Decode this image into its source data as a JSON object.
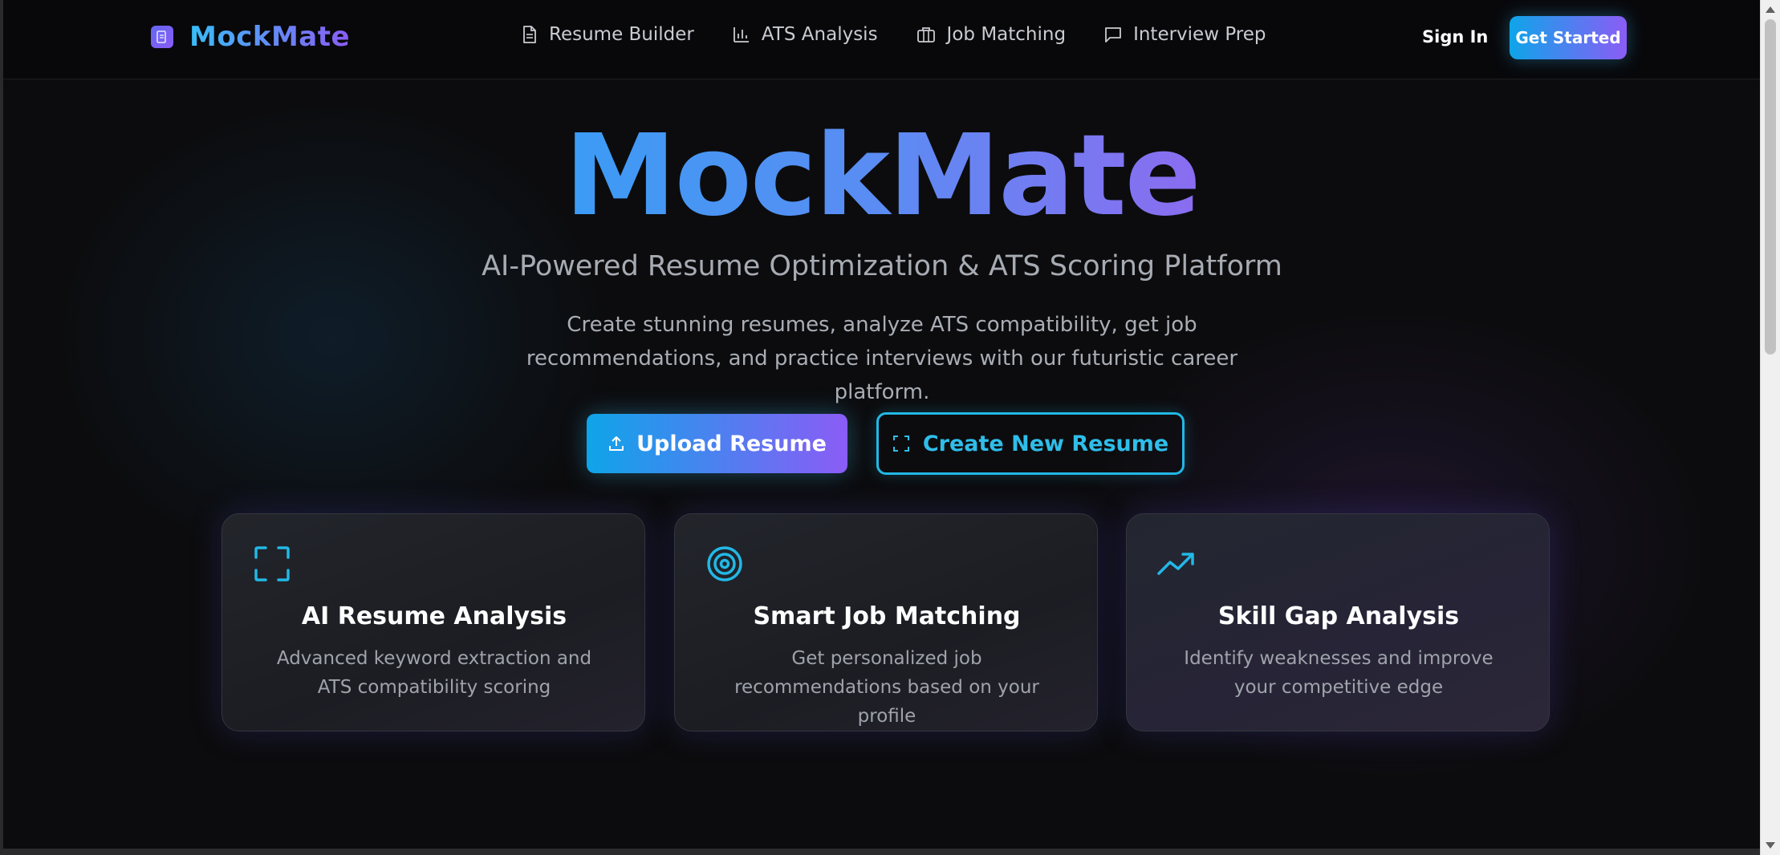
{
  "nav": {
    "brand": "MockMate",
    "links": [
      {
        "label": "Resume Builder",
        "icon": "document-icon"
      },
      {
        "label": "ATS Analysis",
        "icon": "bar-chart-icon"
      },
      {
        "label": "Job Matching",
        "icon": "briefcase-icon"
      },
      {
        "label": "Interview Prep",
        "icon": "message-square-icon"
      }
    ],
    "sign_in": "Sign In",
    "get_started": "Get Started"
  },
  "hero": {
    "title": "MockMate",
    "subtitle": "AI-Powered Resume Optimization & ATS Scoring Platform",
    "description": "Create stunning resumes, analyze ATS compatibility, get job recommendations, and practice interviews with our futuristic career platform.",
    "upload_button": "Upload Resume",
    "create_button": "Create New Resume"
  },
  "features": [
    {
      "title": "AI Resume Analysis",
      "description": "Advanced keyword extraction and ATS compatibility scoring",
      "icon": "scan-icon"
    },
    {
      "title": "Smart Job Matching",
      "description": "Get personalized job recommendations based on your profile",
      "icon": "target-icon"
    },
    {
      "title": "Skill Gap Analysis",
      "description": "Identify weaknesses and improve your competitive edge",
      "icon": "trending-up-icon"
    }
  ],
  "colors": {
    "accent_blue": "#0ea5e9",
    "accent_purple": "#8b5cf6",
    "background": "#0c0c0e",
    "icon_cyan": "#22b8e6"
  }
}
